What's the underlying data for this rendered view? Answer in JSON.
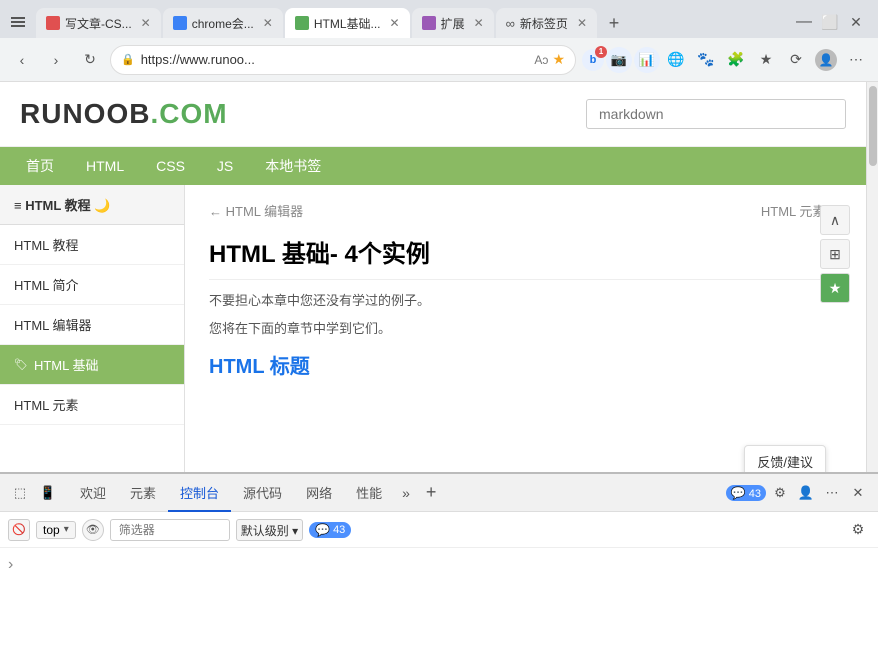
{
  "browser": {
    "tabs": [
      {
        "id": "tab1",
        "label": "写文章-CS...",
        "icon_color": "red",
        "active": false,
        "closable": true
      },
      {
        "id": "tab2",
        "label": "chrome会...",
        "icon_color": "blue",
        "active": false,
        "closable": true
      },
      {
        "id": "tab3",
        "label": "HTML基础...",
        "icon_color": "green",
        "active": true,
        "closable": true
      },
      {
        "id": "tab4",
        "label": "扩展",
        "icon_color": "purple",
        "active": false,
        "closable": true
      },
      {
        "id": "tab5",
        "label": "新标签页",
        "icon_color": "infinity",
        "active": false,
        "closable": true
      }
    ],
    "address": "https://www.runoo...",
    "new_tab_label": "+"
  },
  "site": {
    "logo_text": "RUNOOB",
    "logo_dot": ".",
    "logo_suffix": "COM",
    "search_placeholder": "markdown",
    "nav": [
      "首页",
      "HTML",
      "CSS",
      "JS",
      "本地书签"
    ],
    "sidebar": {
      "title": "HTML 教程 🌙",
      "items": [
        {
          "label": "HTML 教程",
          "active": false
        },
        {
          "label": "HTML 简介",
          "active": false
        },
        {
          "label": "HTML 编辑器",
          "active": false
        },
        {
          "label": "HTML 基础",
          "active": true
        },
        {
          "label": "HTML 元素",
          "active": false
        }
      ]
    },
    "article": {
      "prev_label": "← HTML 编辑器",
      "next_label": "HTML 元素 →",
      "title": "HTML 基础- 4个实例",
      "text1": "不要担心本章中您还没有学过的例子。",
      "text2": "您将在下面的章节中学到它们。",
      "h2": "HTML 标题"
    },
    "floating_panel": "反馈/建议",
    "side_buttons": [
      {
        "icon": "∧",
        "type": "collapse"
      },
      {
        "icon": "⊞",
        "type": "qrcode"
      },
      {
        "icon": "★",
        "type": "star"
      }
    ]
  },
  "devtools": {
    "tabs": [
      {
        "label": "欢迎",
        "active": false
      },
      {
        "label": "元素",
        "active": false
      },
      {
        "label": "控制台",
        "active": true
      },
      {
        "label": "源代码",
        "active": false
      },
      {
        "label": "网络",
        "active": false
      },
      {
        "label": "性能",
        "active": false
      }
    ],
    "more_label": "»",
    "add_label": "+",
    "message_count": "43",
    "console": {
      "top_label": "top",
      "filter_placeholder": "筛选器",
      "level_label": "默认级别",
      "msg_count": "43",
      "caret": "›"
    },
    "right_icons": [
      "⚙",
      "👤",
      "⋯",
      "✕"
    ]
  }
}
